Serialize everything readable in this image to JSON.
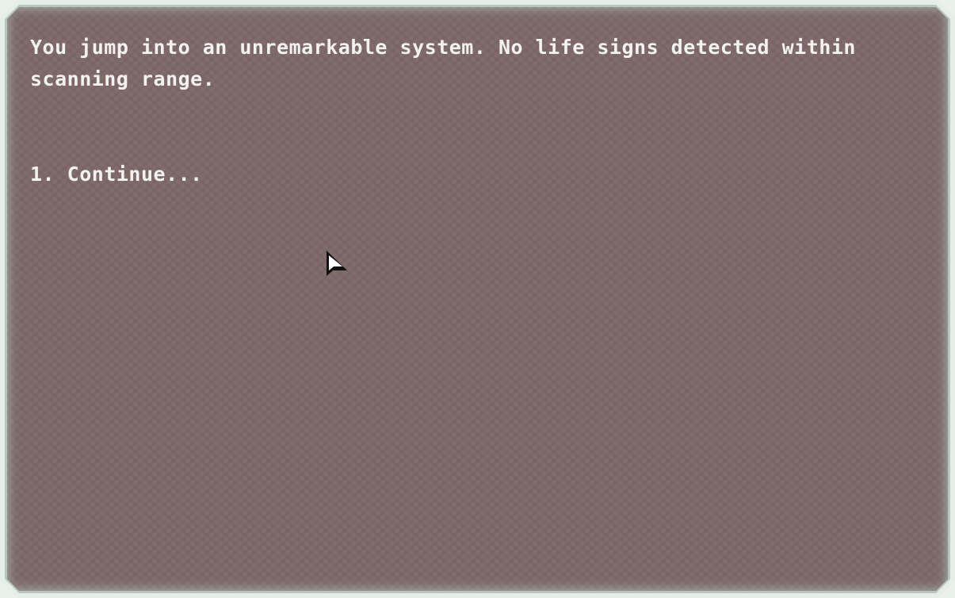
{
  "event": {
    "text": "You jump into an unremarkable system. No life signs detected within scanning range."
  },
  "choices": [
    {
      "number": "1.",
      "label": "Continue..."
    }
  ],
  "colors": {
    "panel": "#7a6565",
    "frame": "#e6efe7",
    "text": "#f4f2f0"
  },
  "icons": {
    "cursor": "mouse-pointer-icon"
  }
}
